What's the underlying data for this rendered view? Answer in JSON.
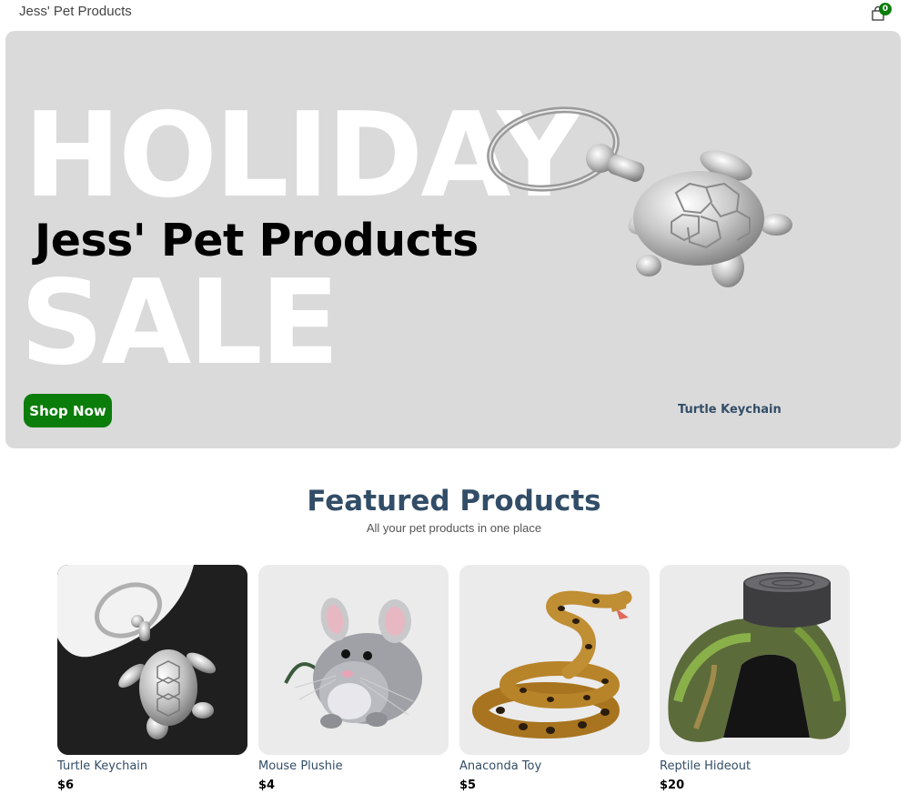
{
  "navbar": {
    "title": "Jess' Pet Products",
    "cart_icon": "shopping-bag-icon",
    "cart_count": "0"
  },
  "hero": {
    "big_text_top": "HOLIDAY",
    "brand": "Jess' Pet Products",
    "big_text_bottom": "SALE",
    "button_label": "Shop Now",
    "product_name": "Turtle Keychain"
  },
  "featured": {
    "title": "Featured Products",
    "subtitle": "All your pet products in one place",
    "products": [
      {
        "name": "Turtle Keychain",
        "price": "$6"
      },
      {
        "name": "Mouse Plushie",
        "price": "$4"
      },
      {
        "name": "Anaconda Toy",
        "price": "$5"
      },
      {
        "name": "Reptile Hideout",
        "price": "$20"
      }
    ]
  },
  "colors": {
    "accent_green": "#0a7d0a",
    "heading_navy": "#324d67",
    "hero_bg": "#dadada"
  }
}
